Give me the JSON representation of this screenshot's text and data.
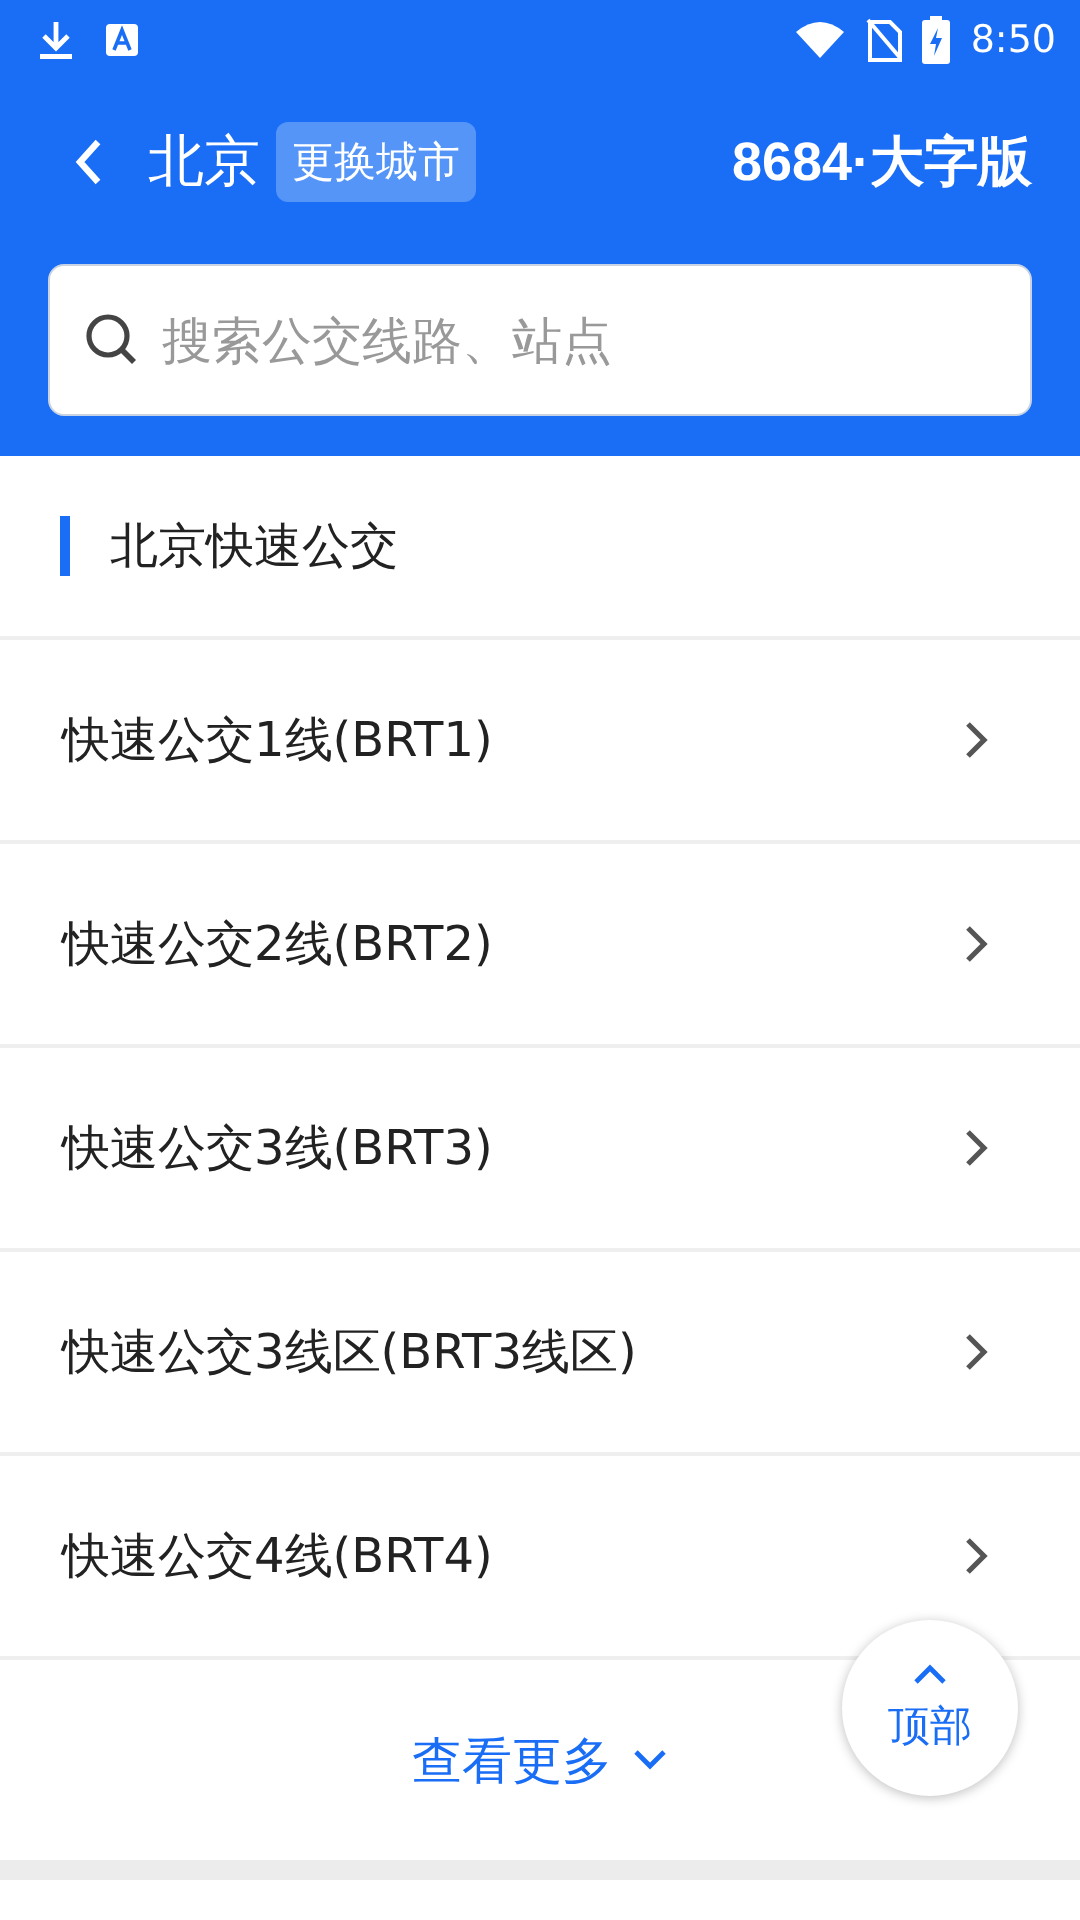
{
  "status_bar": {
    "time": "8:50"
  },
  "header": {
    "city": "北京",
    "change_city": "更换城市",
    "logo": "8684·大字版"
  },
  "search": {
    "placeholder": "搜索公交线路、站点"
  },
  "section": {
    "title": "北京快速公交"
  },
  "routes": [
    {
      "name": "快速公交1线(BRT1)"
    },
    {
      "name": "快速公交2线(BRT2)"
    },
    {
      "name": "快速公交3线(BRT3)"
    },
    {
      "name": "快速公交3线区(BRT3线区)"
    },
    {
      "name": "快速公交4线(BRT4)"
    }
  ],
  "more": {
    "label": "查看更多"
  },
  "top_button": {
    "label": "顶部"
  }
}
